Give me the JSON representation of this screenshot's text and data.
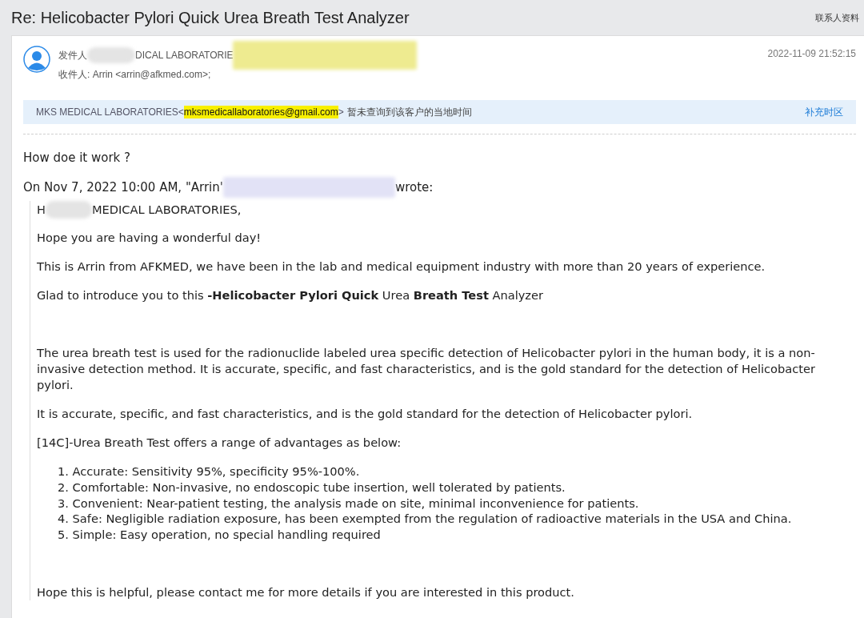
{
  "title": "Re: Helicobacter Pylori Quick Urea Breath Test Analyzer",
  "contact_link": "联系人资料",
  "header": {
    "from_label": "发件人",
    "from_name": "DICAL LABORATORIE",
    "to": "收件人: Arrin <arrin@afkmed.com>;",
    "date": "2022-11-09 21:52:15"
  },
  "notice": {
    "sender": "MKS MEDICAL LABORATORIES<",
    "email": "mksmedicallaboratories@gmail.com",
    "after": ">",
    "message": "暂未查询到该客户的当地时间",
    "action": "补充时区"
  },
  "reply": "How doe it work ?",
  "quote_intro": {
    "before": "On Nov 7, 2022 10:00 AM, \"Arrin'",
    "after": "wrote:"
  },
  "greeting": {
    "before": "H",
    "after": "MEDICAL LABORATORIES,"
  },
  "paragraphs": [
    {
      "kind": "text",
      "text": "Hope you are having a wonderful day!"
    },
    {
      "kind": "text",
      "text": "This is Arrin from AFKMED, we have been in the lab and medical equipment industry with more than 20 years of experience."
    },
    {
      "kind": "text",
      "text": "Glad to introduce you to this **-Helicobacter Pylori Quick** Urea **Breath Test** Analyzer"
    },
    {
      "kind": "gap"
    },
    {
      "kind": "text",
      "text": "The urea breath test is used for the radionuclide labeled urea specific detection of Helicobacter pylori in the human body, it is a non-invasive detection method. It is accurate, specific, and fast characteristics, and is the gold standard for the detection of Helicobacter pylori."
    },
    {
      "kind": "text",
      "text": "It is accurate, specific, and fast characteristics, and is the gold standard for the detection of Helicobacter pylori."
    },
    {
      "kind": "text",
      "text": " [14C]-Urea Breath Test offers a range of advantages as below:"
    },
    {
      "kind": "list",
      "items": [
        "1. Accurate: Sensitivity 95%, specificity 95%-100%.",
        "2. Comfortable: Non-invasive, no endoscopic tube insertion, well tolerated by patients.",
        "3. Convenient: Near-patient testing, the analysis made on site, minimal inconvenience for patients.",
        "4. Safe: Negligible radiation exposure, has been exempted from the regulation of radioactive materials in the USA and China.",
        "5. Simple: Easy operation, no special handling required"
      ]
    },
    {
      "kind": "gap"
    },
    {
      "kind": "text",
      "text": "Hope this is helpful, please contact me for more details if you are interested in this product."
    }
  ]
}
